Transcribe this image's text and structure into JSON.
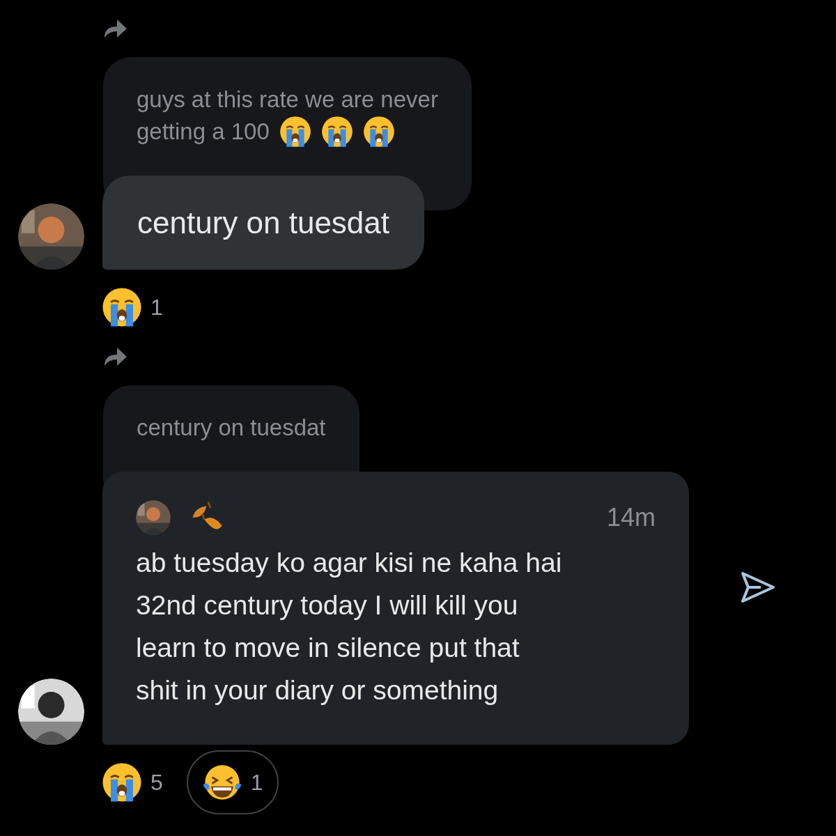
{
  "messages": [
    {
      "forwarded": true,
      "quote": {
        "lines": [
          "guys at this rate we are never",
          "getting a 100"
        ],
        "emojis": [
          {
            "kind": "crying"
          },
          {
            "kind": "crying"
          },
          {
            "kind": "crying"
          }
        ]
      },
      "bubble": {
        "kind": "plain",
        "text": "century on tuesdat"
      },
      "reactions": [
        {
          "kind": "crying",
          "count": "1",
          "selected": false
        }
      ]
    },
    {
      "forwarded": true,
      "quote": {
        "lines": [
          "century on tuesdat"
        ]
      },
      "bubble": {
        "kind": "card",
        "header_emoji": {
          "kind": "leaves"
        },
        "time": "14m",
        "text": "ab tuesday ko agar kisi ne kaha hai\n32nd century today I will kill you\nlearn to move in silence put that\nshit in your diary or something"
      },
      "send": true,
      "reactions": [
        {
          "kind": "crying",
          "count": "5",
          "selected": false
        },
        {
          "kind": "laughing",
          "count": "1",
          "selected": true
        }
      ]
    }
  ]
}
